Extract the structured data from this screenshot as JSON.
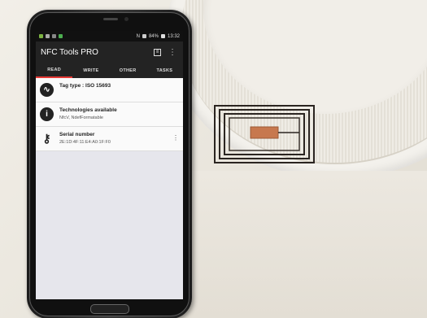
{
  "status_bar": {
    "time": "13:32",
    "battery": "84%"
  },
  "app": {
    "title": "NFC Tools PRO",
    "tabs": [
      {
        "label": "READ",
        "active": true
      },
      {
        "label": "WRITE",
        "active": false
      },
      {
        "label": "OTHER",
        "active": false
      },
      {
        "label": "TASKS",
        "active": false
      }
    ],
    "records": [
      {
        "icon": "waveform-icon",
        "title": "Tag type : ISO 15693",
        "detail": ""
      },
      {
        "icon": "info-icon",
        "title": "Technologies available",
        "detail": "NfcV, NdefFormatable"
      },
      {
        "icon": "key-icon",
        "title": "Serial number",
        "detail": "2E:1D:4F:11:E4:A0:1F:F0"
      }
    ]
  },
  "colors": {
    "tab_indicator": "#e53935",
    "app_bar": "#232323"
  }
}
